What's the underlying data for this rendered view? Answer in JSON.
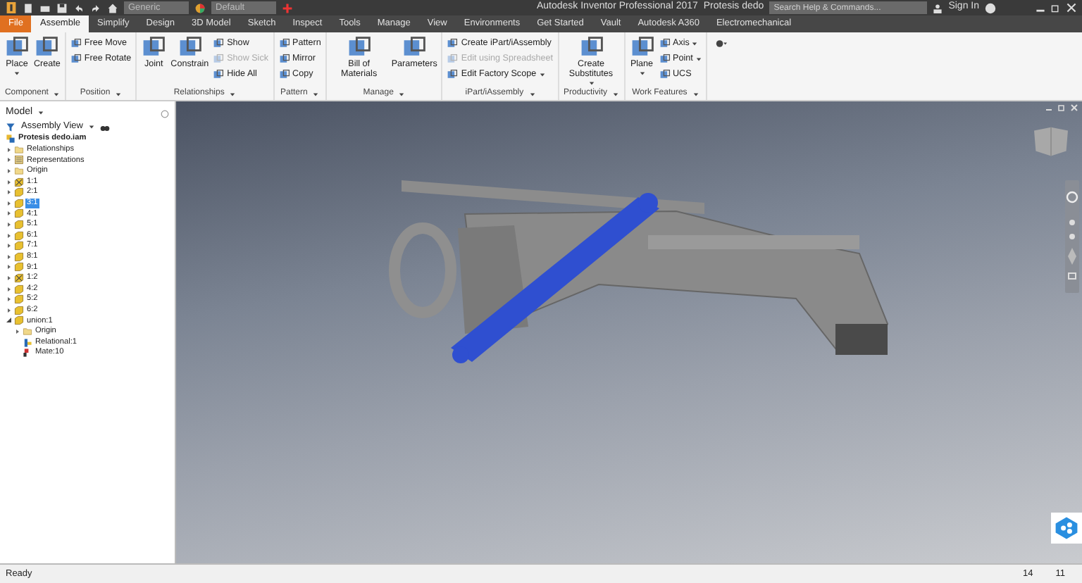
{
  "title_bar": {
    "material": "Generic",
    "appearance": "Default",
    "app_title": "Autodesk Inventor Professional 2017",
    "document": "Protesis dedo",
    "search_placeholder": "Search Help & Commands...",
    "sign_in": "Sign In"
  },
  "tabs": [
    {
      "label": "File",
      "kind": "file",
      "selected": false
    },
    {
      "label": "Assemble",
      "kind": "tab",
      "selected": true
    },
    {
      "label": "Simplify",
      "kind": "tab",
      "selected": false
    },
    {
      "label": "Design",
      "kind": "tab",
      "selected": false
    },
    {
      "label": "3D Model",
      "kind": "tab",
      "selected": false
    },
    {
      "label": "Sketch",
      "kind": "tab",
      "selected": false
    },
    {
      "label": "Inspect",
      "kind": "tab",
      "selected": false
    },
    {
      "label": "Tools",
      "kind": "tab",
      "selected": false
    },
    {
      "label": "Manage",
      "kind": "tab",
      "selected": false
    },
    {
      "label": "View",
      "kind": "tab",
      "selected": false
    },
    {
      "label": "Environments",
      "kind": "tab",
      "selected": false
    },
    {
      "label": "Get Started",
      "kind": "tab",
      "selected": false
    },
    {
      "label": "Vault",
      "kind": "tab",
      "selected": false
    },
    {
      "label": "Autodesk A360",
      "kind": "tab",
      "selected": false
    },
    {
      "label": "Electromechanical",
      "kind": "tab",
      "selected": false
    }
  ],
  "ribbon": [
    {
      "title": "Component",
      "tools": [
        {
          "label": "Place",
          "kind": "large",
          "disabled": false,
          "menu": true
        },
        {
          "label": "Create",
          "kind": "large",
          "disabled": false,
          "menu": false
        }
      ]
    },
    {
      "title": "Position",
      "tools": [
        {
          "label": "Free Move",
          "kind": "small",
          "disabled": false,
          "menu": false
        },
        {
          "label": "Free Rotate",
          "kind": "small",
          "disabled": false,
          "menu": false
        }
      ]
    },
    {
      "title": "Relationships",
      "tools": [
        {
          "label": "Joint",
          "kind": "large",
          "disabled": false,
          "menu": false
        },
        {
          "label": "Constrain",
          "kind": "large",
          "disabled": false,
          "menu": false
        },
        {
          "label": "Show",
          "kind": "small",
          "disabled": false,
          "menu": false
        },
        {
          "label": "Show Sick",
          "kind": "small",
          "disabled": true,
          "menu": false
        },
        {
          "label": "Hide All",
          "kind": "small",
          "disabled": false,
          "menu": false
        }
      ]
    },
    {
      "title": "Pattern",
      "tools": [
        {
          "label": "Pattern",
          "kind": "small",
          "disabled": false,
          "menu": false
        },
        {
          "label": "Mirror",
          "kind": "small",
          "disabled": false,
          "menu": false
        },
        {
          "label": "Copy",
          "kind": "small",
          "disabled": false,
          "menu": false
        }
      ]
    },
    {
      "title": "Manage",
      "tools": [
        {
          "label": "Bill of Materials",
          "kind": "large",
          "disabled": false,
          "menu": false
        },
        {
          "label": "Parameters",
          "kind": "large",
          "disabled": false,
          "menu": false
        }
      ]
    },
    {
      "title": "iPart/iAssembly",
      "tools": [
        {
          "label": "Create iPart/iAssembly",
          "kind": "small",
          "disabled": false,
          "menu": false
        },
        {
          "label": "Edit using Spreadsheet",
          "kind": "small",
          "disabled": true,
          "menu": false
        },
        {
          "label": "Edit Factory Scope",
          "kind": "small",
          "disabled": false,
          "menu": true
        }
      ]
    },
    {
      "title": "Productivity",
      "tools": [
        {
          "label": "Create Substitutes",
          "kind": "large",
          "disabled": false,
          "menu": true
        }
      ]
    },
    {
      "title": "Work Features",
      "tools": [
        {
          "label": "Plane",
          "kind": "large",
          "disabled": false,
          "menu": true
        },
        {
          "label": "Axis",
          "kind": "small",
          "disabled": false,
          "menu": true
        },
        {
          "label": "Point",
          "kind": "small",
          "disabled": false,
          "menu": true
        },
        {
          "label": "UCS",
          "kind": "small",
          "disabled": false,
          "menu": false
        }
      ]
    }
  ],
  "browser": {
    "title": "Model",
    "view": "Assembly View",
    "root": "Protesis dedo.iam",
    "items": [
      {
        "label": "Relationships",
        "kind": "folder",
        "expanded": false,
        "selected": false
      },
      {
        "label": "Representations",
        "kind": "representations",
        "expanded": false,
        "selected": false
      },
      {
        "label": "Origin",
        "kind": "folder",
        "expanded": false,
        "selected": false
      },
      {
        "label": "1:1",
        "kind": "grounded",
        "expanded": false,
        "selected": false
      },
      {
        "label": "2:1",
        "kind": "part",
        "expanded": false,
        "selected": false
      },
      {
        "label": "3:1",
        "kind": "part",
        "expanded": false,
        "selected": true
      },
      {
        "label": "4:1",
        "kind": "part",
        "expanded": false,
        "selected": false
      },
      {
        "label": "5:1",
        "kind": "part",
        "expanded": false,
        "selected": false
      },
      {
        "label": "6:1",
        "kind": "part",
        "expanded": false,
        "selected": false
      },
      {
        "label": "7:1",
        "kind": "part",
        "expanded": false,
        "selected": false
      },
      {
        "label": "8:1",
        "kind": "part",
        "expanded": false,
        "selected": false
      },
      {
        "label": "9:1",
        "kind": "part",
        "expanded": false,
        "selected": false
      },
      {
        "label": "1:2",
        "kind": "grounded",
        "expanded": false,
        "selected": false
      },
      {
        "label": "4:2",
        "kind": "part",
        "expanded": false,
        "selected": false
      },
      {
        "label": "5:2",
        "kind": "part",
        "expanded": false,
        "selected": false
      },
      {
        "label": "6:2",
        "kind": "part",
        "expanded": false,
        "selected": false
      },
      {
        "label": "union:1",
        "kind": "part",
        "expanded": true,
        "selected": false,
        "children": [
          {
            "label": "Origin",
            "kind": "folder",
            "expanded": false,
            "selected": false
          },
          {
            "label": "Relational:1",
            "kind": "joint",
            "selected": false
          },
          {
            "label": "Mate:10",
            "kind": "constraint",
            "selected": false
          }
        ]
      }
    ]
  },
  "status_bar": {
    "text": "Ready",
    "counts": [
      "14",
      "11"
    ]
  }
}
